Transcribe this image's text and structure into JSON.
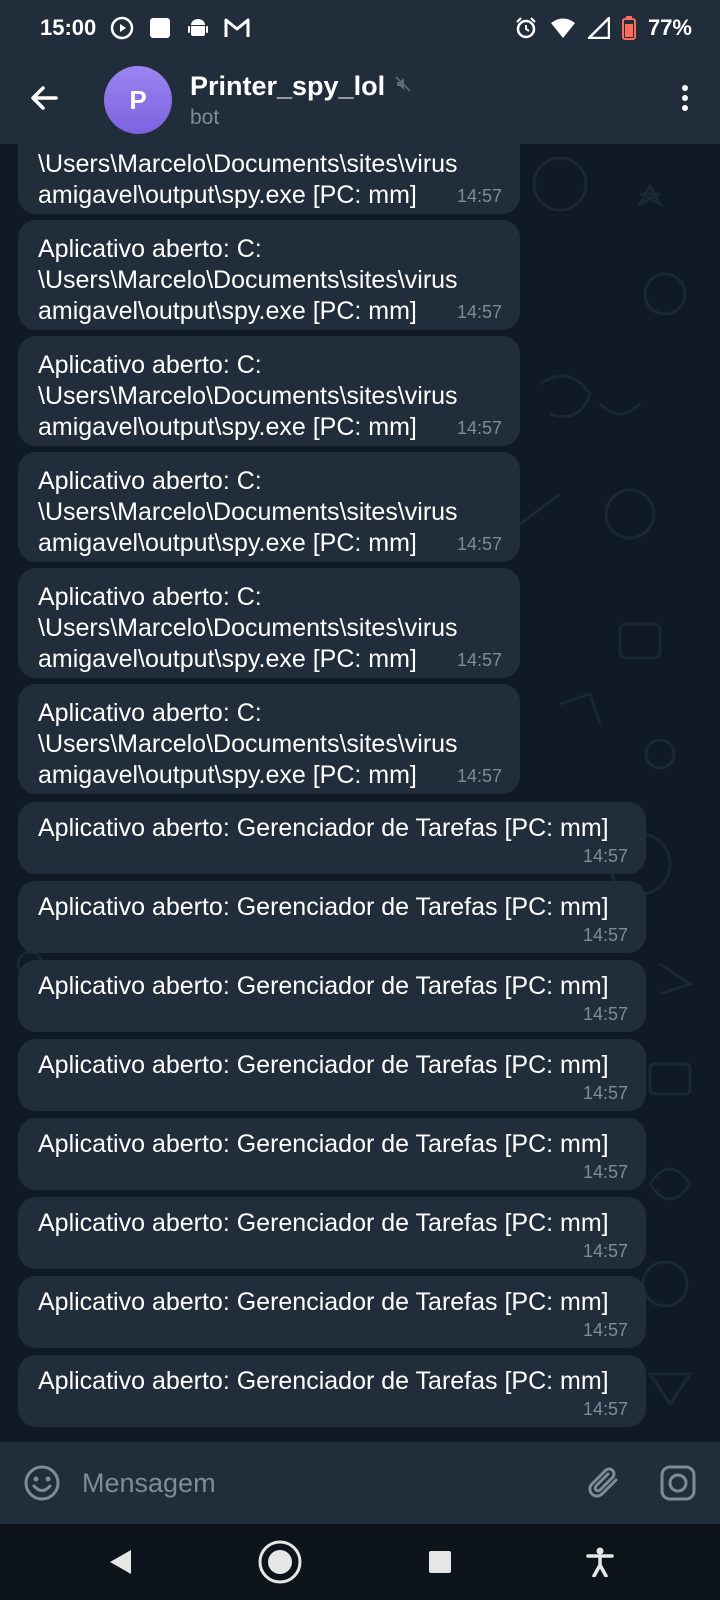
{
  "status_bar": {
    "time": "15:00",
    "battery": "77%"
  },
  "header": {
    "title": "Printer_spy_lol",
    "subtitle": "bot",
    "avatar_letter": "P"
  },
  "messages": {
    "top_partial": {
      "line1": "\\Users\\Marcelo\\Documents\\sites\\virus",
      "line2": "amigavel\\output\\spy.exe [PC: mm]",
      "time": "14:57"
    },
    "long": [
      {
        "line1": "Aplicativo aberto: C:",
        "line2": "\\Users\\Marcelo\\Documents\\sites\\virus",
        "line3": "amigavel\\output\\spy.exe [PC: mm]",
        "time": "14:57"
      },
      {
        "line1": "Aplicativo aberto: C:",
        "line2": "\\Users\\Marcelo\\Documents\\sites\\virus",
        "line3": "amigavel\\output\\spy.exe [PC: mm]",
        "time": "14:57"
      },
      {
        "line1": "Aplicativo aberto: C:",
        "line2": "\\Users\\Marcelo\\Documents\\sites\\virus",
        "line3": "amigavel\\output\\spy.exe [PC: mm]",
        "time": "14:57"
      },
      {
        "line1": "Aplicativo aberto: C:",
        "line2": "\\Users\\Marcelo\\Documents\\sites\\virus",
        "line3": "amigavel\\output\\spy.exe [PC: mm]",
        "time": "14:57"
      },
      {
        "line1": "Aplicativo aberto: C:",
        "line2": "\\Users\\Marcelo\\Documents\\sites\\virus",
        "line3": "amigavel\\output\\spy.exe [PC: mm]",
        "time": "14:57"
      }
    ],
    "short": [
      {
        "text": "Aplicativo aberto: Gerenciador de Tarefas [PC: mm]",
        "time": "14:57"
      },
      {
        "text": "Aplicativo aberto: Gerenciador de Tarefas [PC: mm]",
        "time": "14:57"
      },
      {
        "text": "Aplicativo aberto: Gerenciador de Tarefas [PC: mm]",
        "time": "14:57"
      },
      {
        "text": "Aplicativo aberto: Gerenciador de Tarefas [PC: mm]",
        "time": "14:57"
      },
      {
        "text": "Aplicativo aberto: Gerenciador de Tarefas [PC: mm]",
        "time": "14:57"
      },
      {
        "text": "Aplicativo aberto: Gerenciador de Tarefas [PC: mm]",
        "time": "14:57"
      },
      {
        "text": "Aplicativo aberto: Gerenciador de Tarefas [PC: mm]",
        "time": "14:57"
      },
      {
        "text": "Aplicativo aberto: Gerenciador de Tarefas [PC: mm]",
        "time": "14:57"
      }
    ]
  },
  "input": {
    "placeholder": "Mensagem"
  },
  "icons": {
    "status": [
      "play-circle-icon",
      "square-notification-icon",
      "android-icon",
      "gmail-icon",
      "alarm-icon",
      "wifi-icon",
      "signal-icon",
      "battery-icon"
    ],
    "header": [
      "back-arrow-icon",
      "muted-icon",
      "more-vertical-icon"
    ],
    "input": [
      "emoji-icon",
      "attach-icon",
      "camera-icon"
    ],
    "nav": [
      "nav-back-icon",
      "nav-home-icon",
      "nav-recents-icon",
      "accessibility-icon"
    ]
  },
  "colors": {
    "header_bg": "#212d3b",
    "chat_bg": "#0f1a26",
    "bubble_bg": "#212d3b",
    "secondary_text": "#7f8b99",
    "avatar": "#8a72e8"
  }
}
